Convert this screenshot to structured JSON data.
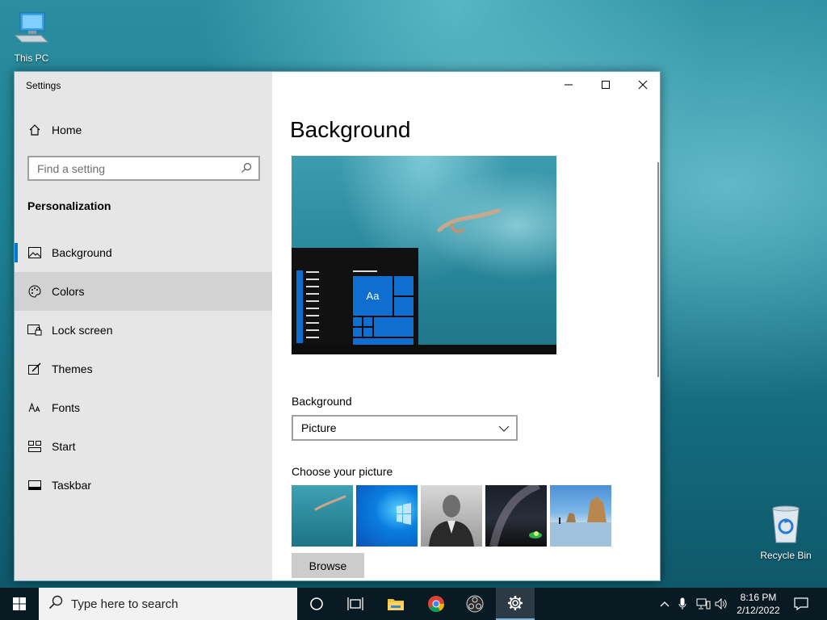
{
  "desktop": {
    "this_pc_label": "This PC",
    "recycle_bin_label": "Recycle Bin"
  },
  "window": {
    "title": "Settings",
    "sidebar": {
      "home_label": "Home",
      "search_placeholder": "Find a setting",
      "section_title": "Personalization",
      "items": [
        {
          "label": "Background",
          "icon": "image-icon"
        },
        {
          "label": "Colors",
          "icon": "palette-icon"
        },
        {
          "label": "Lock screen",
          "icon": "lock-screen-icon"
        },
        {
          "label": "Themes",
          "icon": "themes-icon"
        },
        {
          "label": "Fonts",
          "icon": "fonts-icon"
        },
        {
          "label": "Start",
          "icon": "start-icon"
        },
        {
          "label": "Taskbar",
          "icon": "taskbar-icon"
        }
      ]
    },
    "content": {
      "page_title": "Background",
      "preview_tile_text": "Aa",
      "background_label": "Background",
      "background_value": "Picture",
      "choose_label": "Choose your picture",
      "browse_label": "Browse"
    }
  },
  "taskbar": {
    "search_placeholder": "Type here to search",
    "time": "8:16 PM",
    "date": "2/12/2022"
  },
  "colors": {
    "accent": "#0078d7",
    "sidebar_bg": "#e6e6e6",
    "taskbar_bg": "#0a1a22"
  }
}
